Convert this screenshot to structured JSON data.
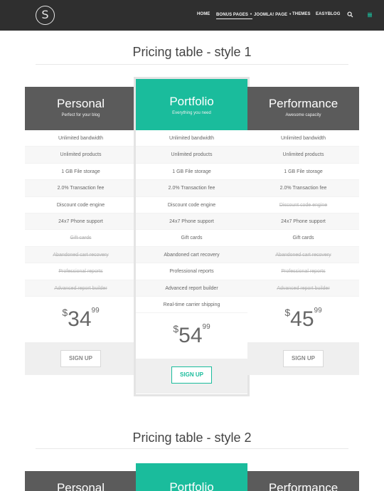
{
  "header": {
    "logo_letter": "S",
    "nav": [
      {
        "label": "HOME"
      },
      {
        "label": "BONUS PAGES"
      },
      {
        "label": "JOOMLA! PAGE"
      },
      {
        "label": "THEMES"
      },
      {
        "label": "EASYBLOG"
      }
    ],
    "icons": [
      "search-icon",
      "menu-icon"
    ],
    "accent_color": "#1abc9c"
  },
  "section1": {
    "title": "Pricing table - style 1",
    "plans": [
      {
        "name": "Personal",
        "subtitle": "Perfect for your blog",
        "features": [
          "Unlimited bandwidth",
          "Unlimited products",
          "1 GB File storage",
          "2.0% Transaction fee",
          "Discount code engine",
          "24x7 Phone support",
          "Gift cards",
          "Abandoned cart recovery",
          "Professional reports",
          "Advanced report builder"
        ],
        "currency": "$",
        "price": "34",
        "cents": "99",
        "button": "SIGN UP"
      },
      {
        "name": "Portfolio",
        "subtitle": "Everything you need",
        "features": [
          "Unlimited bandwidth",
          "Unlimited products",
          "1 GB File storage",
          "2.0% Transaction fee",
          "Discount code engine",
          "24x7 Phone support",
          "Gift cards",
          "Abandoned cart recovery",
          "Professional reports",
          "Advanced report builder",
          "Real-time carrier shipping"
        ],
        "currency": "$",
        "price": "54",
        "cents": "99",
        "button": "SIGN UP"
      },
      {
        "name": "Performance",
        "subtitle": "Awesome capacity",
        "features": [
          "Unlimited bandwidth",
          "Unlimited products",
          "1 GB File storage",
          "2.0% Transaction fee",
          "Discount code engine",
          "24x7 Phone support",
          "Gift cards",
          "Abandoned cart recovery",
          "Professional reports",
          "Advanced report builder"
        ],
        "currency": "$",
        "price": "45",
        "cents": "99",
        "button": "SIGN UP"
      }
    ]
  },
  "section2": {
    "title": "Pricing table - style 2",
    "plans": [
      {
        "name": "Personal"
      },
      {
        "name": "Portfolio"
      },
      {
        "name": "Performance"
      }
    ]
  }
}
